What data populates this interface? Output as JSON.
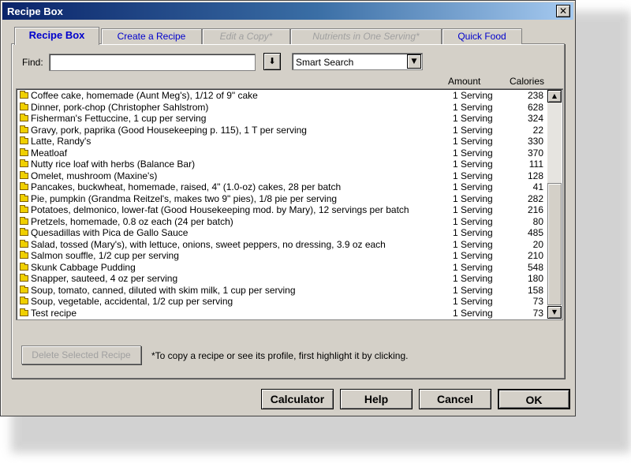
{
  "window": {
    "title": "Recipe Box",
    "close_glyph": "✕"
  },
  "tabs": [
    {
      "label": "Recipe Box",
      "state": "active"
    },
    {
      "label": "Create a Recipe",
      "state": "enabled"
    },
    {
      "label": "Edit a Copy*",
      "state": "disabled"
    },
    {
      "label": "Nutrients in One Serving*",
      "state": "disabled"
    },
    {
      "label": "Quick Food",
      "state": "enabled"
    }
  ],
  "find": {
    "label": "Find:",
    "value": "",
    "download_glyph": "⬇",
    "search_mode": "Smart Search",
    "dropdown_glyph": "▼"
  },
  "columns": {
    "amount": "Amount",
    "calories": "Calories"
  },
  "recipes": [
    {
      "name": "Coffee cake, homemade (Aunt Meg's), 1/12 of 9\" cake",
      "amount": "1 Serving",
      "calories": "238"
    },
    {
      "name": "Dinner, pork-chop (Christopher Sahlstrom)",
      "amount": "1 Serving",
      "calories": "628"
    },
    {
      "name": "Fisherman's Fettuccine, 1 cup per serving",
      "amount": "1 Serving",
      "calories": "324"
    },
    {
      "name": "Gravy, pork, paprika (Good Housekeeping p. 115), 1 T per serving",
      "amount": "1 Serving",
      "calories": "22"
    },
    {
      "name": "Latte, Randy's",
      "amount": "1 Serving",
      "calories": "330"
    },
    {
      "name": "Meatloaf",
      "amount": "1 Serving",
      "calories": "370"
    },
    {
      "name": "Nutty rice loaf with herbs (Balance Bar)",
      "amount": "1 Serving",
      "calories": "111"
    },
    {
      "name": "Omelet, mushroom (Maxine's)",
      "amount": "1 Serving",
      "calories": "128"
    },
    {
      "name": "Pancakes, buckwheat, homemade, raised, 4\" (1.0-oz) cakes, 28 per batch",
      "amount": "1 Serving",
      "calories": "41"
    },
    {
      "name": "Pie, pumpkin (Grandma Reitzel's, makes two 9\" pies), 1/8 pie per serving",
      "amount": "1 Serving",
      "calories": "282"
    },
    {
      "name": "Potatoes, delmonico, lower-fat (Good Housekeeping mod. by Mary), 12 servings per batch",
      "amount": "1 Serving",
      "calories": "216"
    },
    {
      "name": "Pretzels, homemade, 0.8 oz each (24 per batch)",
      "amount": "1 Serving",
      "calories": "80"
    },
    {
      "name": "Quesadillas with Pica de Gallo Sauce",
      "amount": "1 Serving",
      "calories": "485"
    },
    {
      "name": "Salad, tossed (Mary's), with lettuce, onions, sweet peppers, no dressing, 3.9 oz each",
      "amount": "1 Serving",
      "calories": "20"
    },
    {
      "name": "Salmon souffle, 1/2 cup per serving",
      "amount": "1 Serving",
      "calories": "210"
    },
    {
      "name": "Skunk Cabbage Pudding",
      "amount": "1 Serving",
      "calories": "548"
    },
    {
      "name": "Snapper, sauteed, 4 oz per serving",
      "amount": "1 Serving",
      "calories": "180"
    },
    {
      "name": "Soup, tomato, canned, diluted with skim milk, 1 cup per serving",
      "amount": "1 Serving",
      "calories": "158"
    },
    {
      "name": "Soup, vegetable, accidental, 1/2 cup per serving",
      "amount": "1 Serving",
      "calories": "73"
    },
    {
      "name": "Test recipe",
      "amount": "1 Serving",
      "calories": "73"
    }
  ],
  "scrollbar": {
    "up_glyph": "▲",
    "down_glyph": "▼"
  },
  "delete_button": {
    "label": "Delete Selected Recipe",
    "enabled": false
  },
  "hint": "*To copy a recipe or see its profile, first highlight it by clicking.",
  "buttons": {
    "calculator": "Calculator",
    "help": "Help",
    "cancel": "Cancel",
    "ok": "OK"
  }
}
